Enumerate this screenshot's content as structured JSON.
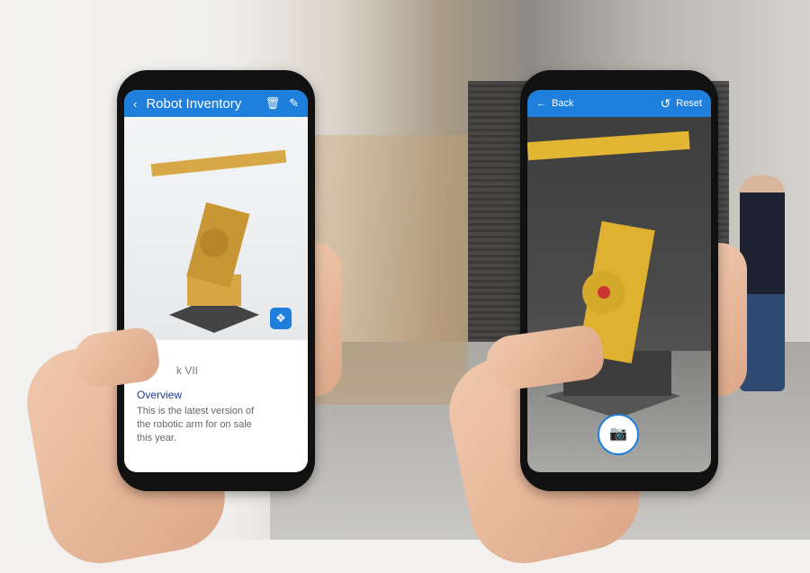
{
  "left_phone": {
    "header": {
      "title": "Robot Inventory",
      "back_icon": "chevron-left-icon",
      "delete_icon": "trash-icon",
      "edit_icon": "pencil-icon"
    },
    "view_ar_icon": "ar-cube-icon",
    "item_name_partial": "k VII",
    "section_title": "Overview",
    "description": "This is the latest version of the robotic arm for on sale this year."
  },
  "right_phone": {
    "header": {
      "back_label": "Back",
      "reset_label": "Reset",
      "back_icon": "arrow-left-icon",
      "reset_icon": "undo-icon"
    },
    "capture_icon": "camera-icon"
  },
  "colors": {
    "accent": "#1e7fdc",
    "section_title": "#1f3a93",
    "robot": "#e0b030"
  }
}
